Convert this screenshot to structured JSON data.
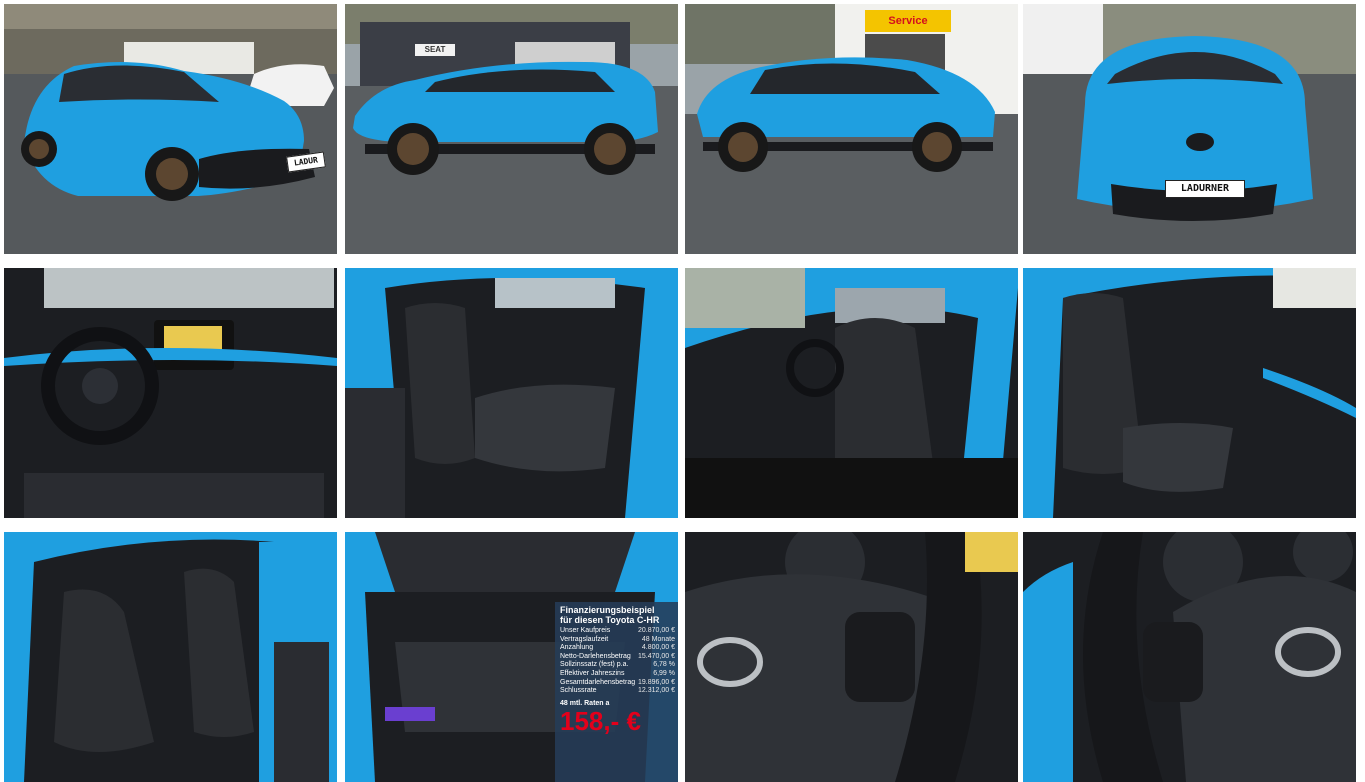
{
  "gallery": {
    "plate_text": "LADURNER",
    "plate_text_small": "LADUR",
    "service_sign": "Service",
    "dealer_sign": "SEAT"
  },
  "financing": {
    "title_line1": "Finanzierungsbeispiel",
    "title_line2": "für diesen Toyota C-HR",
    "rows": [
      {
        "label": "Unser Kaufpreis",
        "value": "20.870,00 €"
      },
      {
        "label": "Vertragslaufzeit",
        "value": "48 Monate"
      },
      {
        "label": "Anzahlung",
        "value": "4.800,00 €"
      },
      {
        "label": "Netto-Darlehensbetrag",
        "value": "15.470,00 €"
      },
      {
        "label": "Sollzinssatz (fest) p.a.",
        "value": "6,78 %"
      },
      {
        "label": "Effektiver Jahreszins",
        "value": "6,99 %"
      },
      {
        "label": "Gesamtdarlehensbetrag",
        "value": "19.896,00 €"
      },
      {
        "label": "Schlussrate",
        "value": "12.312,00 €"
      }
    ],
    "rate_label": "48 mtl. Raten a",
    "rate_value": "158,- €"
  },
  "colors": {
    "car_blue": "#1f9fe0",
    "interior_black": "#1c1e22",
    "asphalt": "#55595c",
    "rate_red": "#e3001b"
  }
}
